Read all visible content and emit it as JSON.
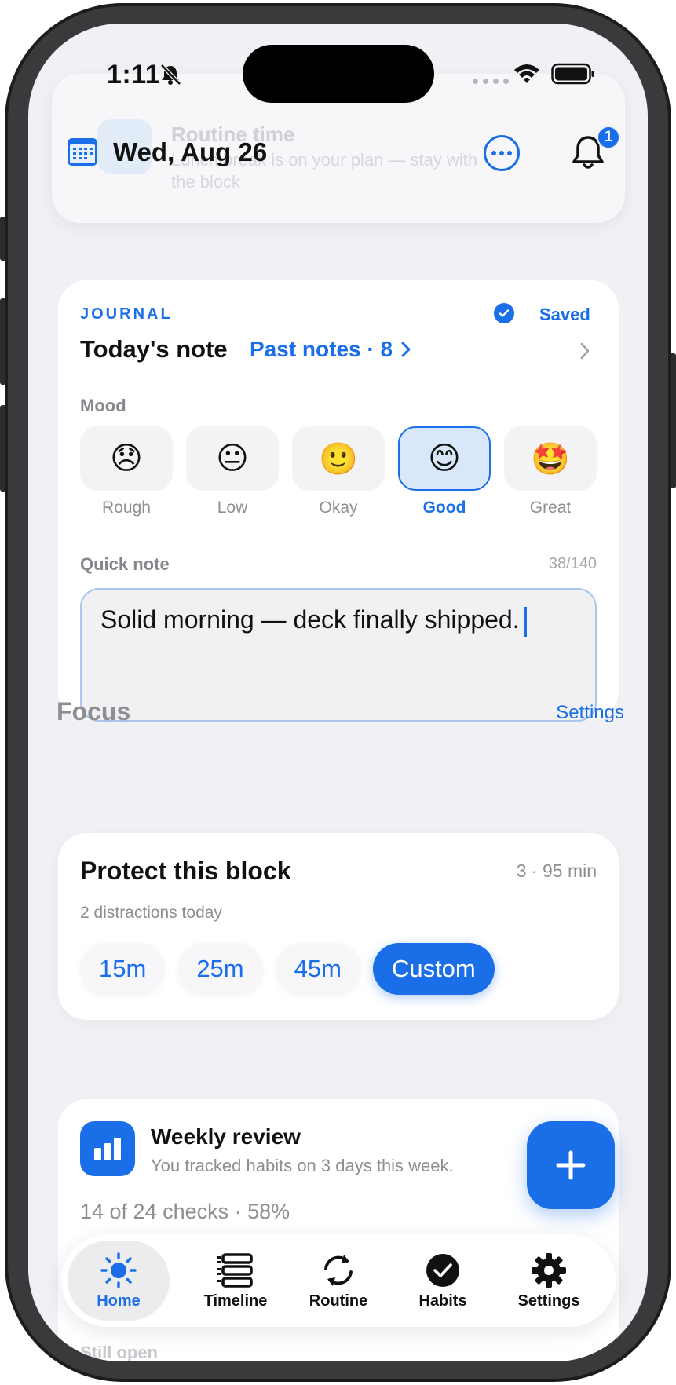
{
  "status_bar": {
    "time": "1:11"
  },
  "ghost_notification": {
    "title": "Routine time",
    "body_line1": "Lunch break is on your plan — stay with",
    "body_line2": "the block"
  },
  "header": {
    "date": "Wed, Aug 26",
    "notification_count": "1"
  },
  "journal": {
    "label": "JOURNAL",
    "saved_label": "Saved",
    "title": "Today's note",
    "past_notes_label": "Past notes · 8",
    "mood_label": "Mood",
    "moods": [
      {
        "emoji": "😞",
        "label": "Rough"
      },
      {
        "emoji": "😐",
        "label": "Low"
      },
      {
        "emoji": "🙂",
        "label": "Okay"
      },
      {
        "emoji": "😊",
        "label": "Good"
      },
      {
        "emoji": "🤩",
        "label": "Great"
      }
    ],
    "selected_mood": "Good",
    "quick_note_label": "Quick note",
    "quick_note_count": "38/140",
    "quick_note_value": "Solid morning — deck finally shipped."
  },
  "focus": {
    "heading": "Focus",
    "settings_label": "Settings",
    "card_title": "Protect this block",
    "card_meta": "3 · 95 min",
    "distractions": "2 distractions today",
    "durations": [
      "15m",
      "25m",
      "45m",
      "Custom"
    ],
    "selected_duration": "Custom"
  },
  "weekly_review": {
    "title": "Weekly review",
    "subtitle": "You tracked habits on 3 days this week.",
    "stats": "14 of 24 checks · 58%",
    "still_open": "Still open"
  },
  "tabs": [
    {
      "label": "Home",
      "icon": "sun-icon"
    },
    {
      "label": "Timeline",
      "icon": "timeline-icon"
    },
    {
      "label": "Routine",
      "icon": "refresh-icon"
    },
    {
      "label": "Habits",
      "icon": "checkmark-circle-icon"
    },
    {
      "label": "Settings",
      "icon": "gear-icon"
    }
  ],
  "active_tab": "Home",
  "colors": {
    "accent": "#1a6ee8",
    "background": "#f1f1f5",
    "card": "#ffffff",
    "secondary_text": "#8e8e93"
  }
}
